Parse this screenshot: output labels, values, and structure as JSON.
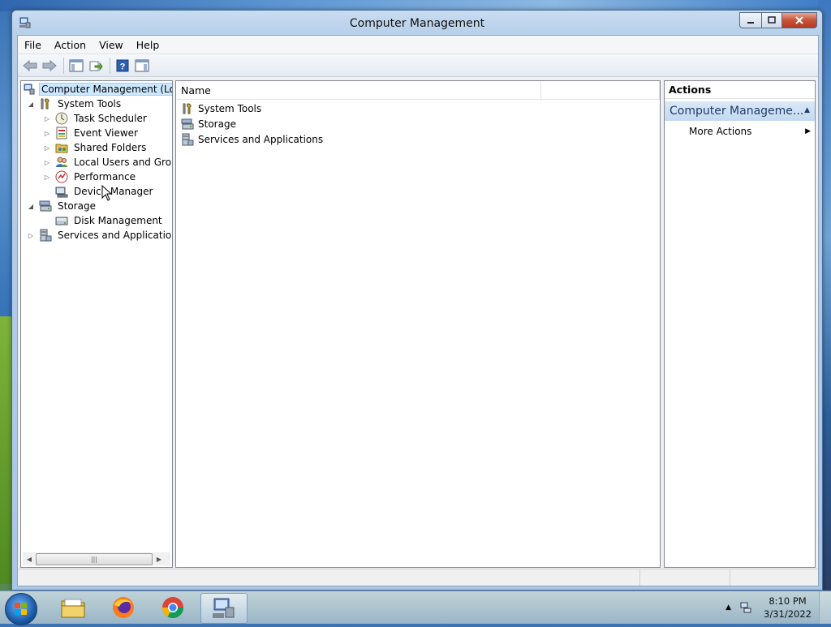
{
  "window": {
    "title": "Computer Management"
  },
  "menu": [
    "File",
    "Action",
    "View",
    "Help"
  ],
  "toolbar": {
    "buttons": [
      "back-icon",
      "forward-icon",
      "show-hide-console-tree-icon",
      "export-list-icon",
      "help-icon",
      "show-hide-action-pane-icon"
    ]
  },
  "tree": {
    "items": [
      {
        "label": "Computer Management (Local",
        "icon": "computer-management-icon",
        "expanded": null,
        "selected": true
      },
      {
        "label": "System Tools",
        "icon": "tools-icon",
        "expanded": true
      },
      {
        "label": "Task Scheduler",
        "icon": "clock-icon",
        "expanded": false
      },
      {
        "label": "Event Viewer",
        "icon": "event-viewer-icon",
        "expanded": false
      },
      {
        "label": "Shared Folders",
        "icon": "shared-folders-icon",
        "expanded": false
      },
      {
        "label": "Local Users and Groups",
        "icon": "users-icon",
        "expanded": false
      },
      {
        "label": "Performance",
        "icon": "performance-icon",
        "expanded": false
      },
      {
        "label": "Device Manager",
        "icon": "device-manager-icon",
        "expanded": null
      },
      {
        "label": "Storage",
        "icon": "storage-icon",
        "expanded": true
      },
      {
        "label": "Disk Management",
        "icon": "disk-icon",
        "expanded": null
      },
      {
        "label": "Services and Applications",
        "icon": "services-icon",
        "expanded": false
      }
    ]
  },
  "list": {
    "columns": [
      "Name",
      ""
    ],
    "rows": [
      {
        "label": "System Tools",
        "icon": "tools-icon"
      },
      {
        "label": "Storage",
        "icon": "storage-icon"
      },
      {
        "label": "Services and Applications",
        "icon": "services-icon"
      }
    ]
  },
  "actions": {
    "header": "Actions",
    "section": "Computer Manageme...",
    "items": [
      {
        "label": "More Actions"
      }
    ]
  },
  "taskbar": {
    "apps": [
      "file-explorer-icon",
      "firefox-icon",
      "chrome-icon",
      "computer-management-icon"
    ],
    "time": "8:10 PM",
    "date": "3/31/2022"
  },
  "colors": {
    "selection": "#cce8ff",
    "accent": "#1e3f66",
    "close": "#c7543a"
  }
}
